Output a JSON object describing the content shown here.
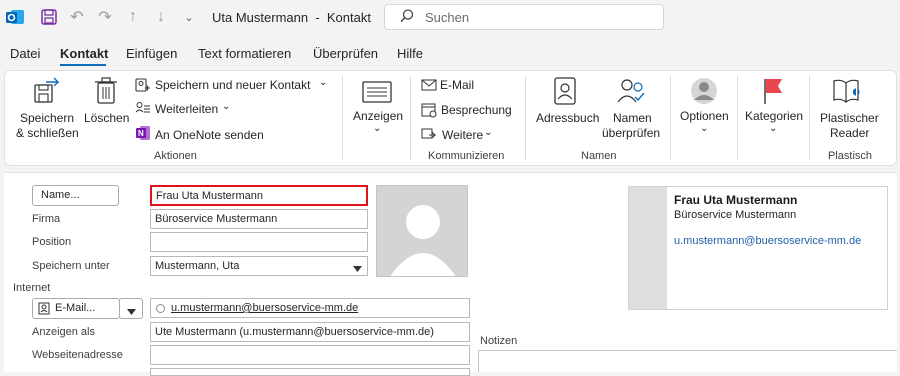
{
  "window": {
    "title": "Uta Mustermann  -  Kontakt"
  },
  "search": {
    "placeholder": "Suchen"
  },
  "menu": {
    "tabs": [
      "Datei",
      "Kontakt",
      "Einfügen",
      "Text formatieren",
      "Überprüfen",
      "Hilfe"
    ]
  },
  "ribbon": {
    "aktionen": {
      "save_close": [
        "Speichern",
        "& schließen"
      ],
      "delete": "Löschen",
      "save_new": "Speichern und neuer Kontakt",
      "forward": "Weiterleiten",
      "onenote": "An OneNote senden",
      "group": "Aktionen"
    },
    "anzeigen": {
      "label": "Anzeigen"
    },
    "kommunizieren": {
      "email": "E-Mail",
      "meeting": "Besprechung",
      "more": "Weitere",
      "group": "Kommunizieren"
    },
    "namen": {
      "address_book": "Adressbuch",
      "check_names": [
        "Namen",
        "überprüfen"
      ],
      "group": "Namen"
    },
    "optionen": {
      "label": "Optionen"
    },
    "kategorien": {
      "label": "Kategorien"
    },
    "plastisch": {
      "reader": [
        "Plastischer",
        "Reader"
      ],
      "group": "Plastisch"
    },
    "colors": {
      "accent": "#0f6cbd",
      "category_flag": "#e8474f",
      "onenote": "#7719aa"
    }
  },
  "form": {
    "name_button": "Name...",
    "name_value": "Frau Uta Mustermann",
    "firma_label": "Firma",
    "firma_value": "Büroservice Mustermann",
    "position_label": "Position",
    "position_value": "",
    "save_as_label": "Speichern unter",
    "save_as_value": "Mustermann, Uta",
    "internet_label": "Internet",
    "email_button": "E-Mail...",
    "email_value": "u.mustermann@buersoservice-mm.de",
    "display_label": "Anzeigen als",
    "display_value": "Ute Mustermann (u.mustermann@buersoservice-mm.de)",
    "website_label": "Webseitenadresse",
    "website_value": "",
    "notes_label": "Notizen"
  },
  "card": {
    "name": "Frau Uta Mustermann",
    "company": "Büroservice Mustermann",
    "email": "u.mustermann@buersoservice-mm.de"
  }
}
